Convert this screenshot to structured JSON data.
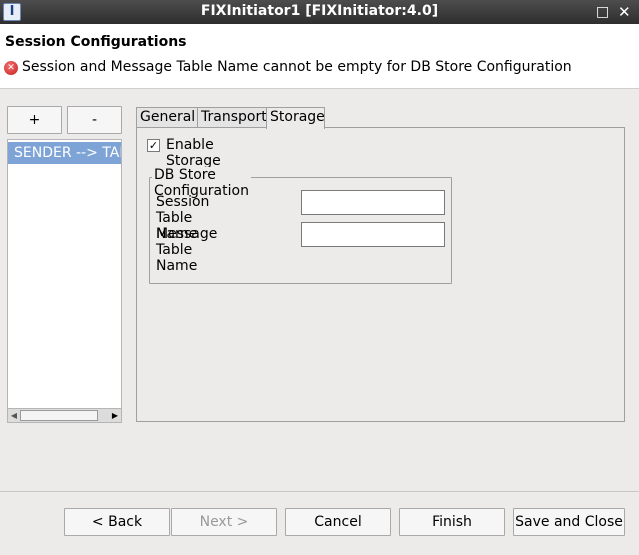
{
  "window": {
    "title": "FIXInitiator1 [FIXInitiator:4.0]",
    "app_icon_glyph": "I",
    "minimize_glyph": "□",
    "close_glyph": "✕"
  },
  "header": {
    "title": "Session Configurations",
    "error_message": "Session and Message Table Name cannot be empty for DB Store Configuration",
    "error_icon_glyph": "✕"
  },
  "session_list": {
    "add_label": "+",
    "remove_label": "-",
    "items": [
      "SENDER --> TARGET"
    ],
    "scroll_left_glyph": "◀",
    "scroll_right_glyph": "▶"
  },
  "tabs": [
    {
      "label": "General"
    },
    {
      "label": "Transport"
    },
    {
      "label": "Storage"
    }
  ],
  "storage": {
    "enable_label": "Enable Storage",
    "enable_checked_glyph": "✓",
    "db_group_label": "DB Store Configuration",
    "session_table_label": "Session Table Name",
    "session_table_value": "",
    "message_table_label": "Message Table Name",
    "message_table_value": ""
  },
  "footer": {
    "back_label": "< Back",
    "next_label": "Next >",
    "cancel_label": "Cancel",
    "finish_label": "Finish",
    "save_close_label": "Save and Close"
  }
}
